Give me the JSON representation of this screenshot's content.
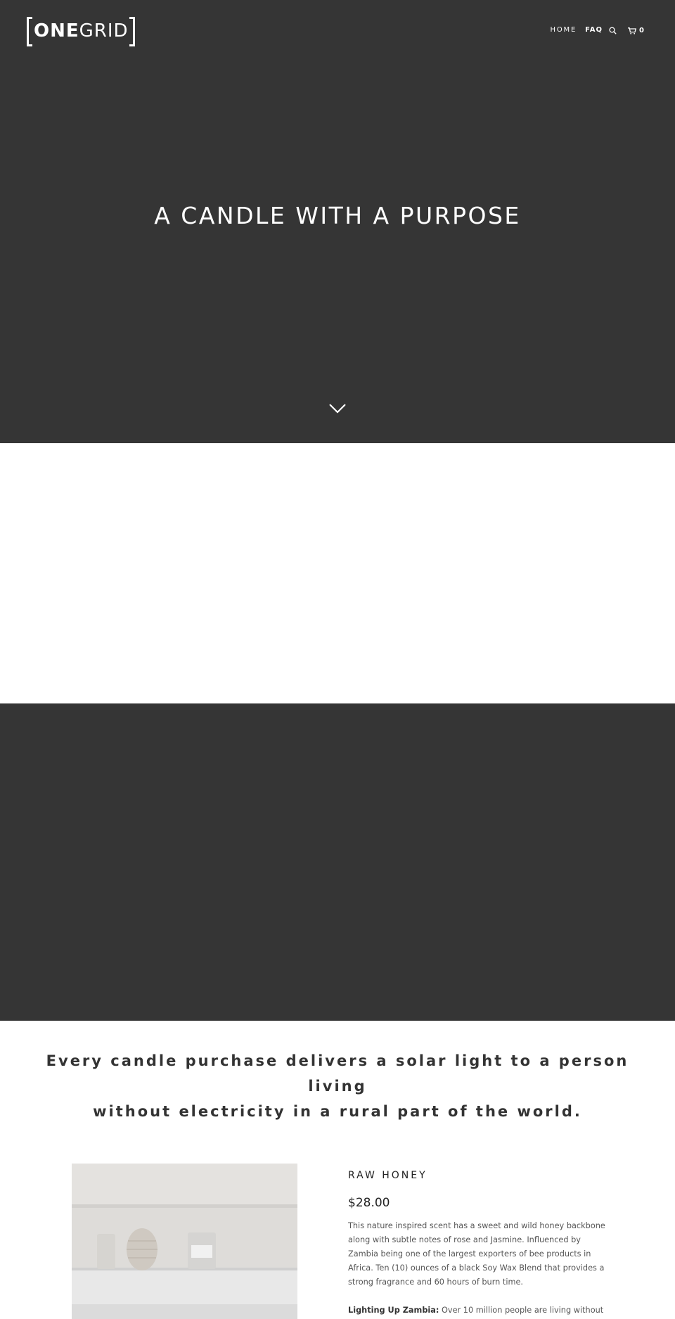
{
  "brand": {
    "logo_bold": "ONE",
    "logo_light": "GRID"
  },
  "nav": {
    "home": "HOME",
    "faq": "FAQ",
    "search_icon": "search-icon",
    "cart_icon": "cart-icon",
    "cart_count": "0"
  },
  "hero": {
    "title": "A CANDLE WITH A PURPOSE",
    "scroll_icon": "chevron-down-icon"
  },
  "mission": {
    "line1": "Every candle purchase delivers a solar light to a person living",
    "line2": "without electricity in a rural part of the world."
  },
  "product": {
    "title": "RAW HONEY",
    "price": "$28.00",
    "description": "This nature inspired scent has a sweet and wild honey backbone along with subtle notes of rose and Jasmine. Influenced by Zambia being one of the largest exporters of bee products in Africa. Ten (10) ounces of a black Soy Wax Blend that provides a strong fragrance and 60 hours of burn time.",
    "impact_label": "Lighting Up Zambia:",
    "impact_text": " Over 10 million people are living without"
  },
  "colors": {
    "dark": "#353535",
    "white": "#ffffff",
    "text": "#333333"
  }
}
